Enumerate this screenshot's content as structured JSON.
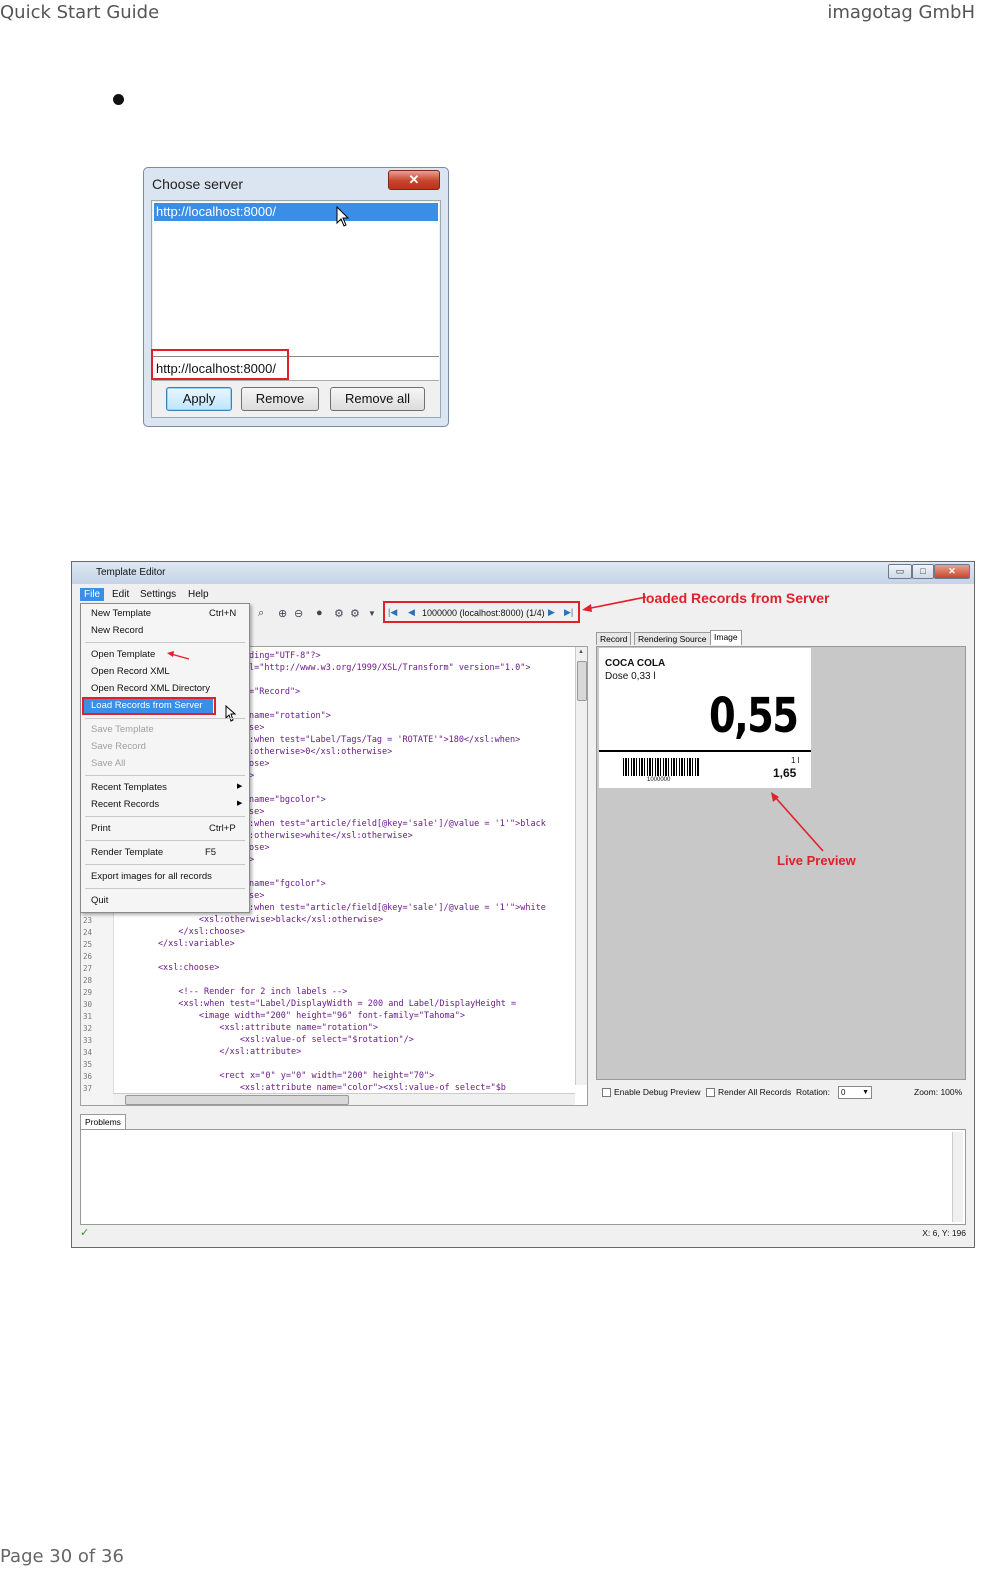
{
  "header": {
    "left": "Quick Start Guide",
    "right": "imagotag GmbH"
  },
  "footer": {
    "page": "Page 30 of 36"
  },
  "dialog": {
    "title": "Choose server",
    "close_icon": "close-icon",
    "list_item": "http://localhost:8000/",
    "input_value": "http://localhost:8000/",
    "buttons": {
      "apply": "Apply",
      "remove": "Remove",
      "remove_all": "Remove all"
    }
  },
  "editor": {
    "title": "Template Editor",
    "window_buttons": {
      "minimize": "▭",
      "maximize": "□",
      "close": "✕"
    },
    "menu": {
      "file": "File",
      "edit": "Edit",
      "settings": "Settings",
      "help": "Help"
    },
    "file_menu": {
      "new_template": "New Template",
      "new_template_sc": "Ctrl+N",
      "new_record": "New Record",
      "open_template": "Open Template",
      "open_record_xml": "Open Record XML",
      "open_record_xml_dir": "Open Record XML Directory",
      "load_records": "Load Records from Server",
      "save_template": "Save Template",
      "save_record": "Save Record",
      "save_all": "Save All",
      "recent_templates": "Recent Templates",
      "recent_records": "Recent Records",
      "print": "Print",
      "print_sc": "Ctrl+P",
      "render_template": "Render Template",
      "render_sc": "F5",
      "export_images": "Export images for all records",
      "quit": "Quit"
    },
    "nav_record": "1000000 (localhost:8000) (1/4)",
    "code_lines": [
      {
        "n": "",
        "t": "ding=\"UTF-8\"?>"
      },
      {
        "n": "",
        "t": "l=\"http://www.w3.org/1999/XSL/Transform\" version=\"1.0\">"
      },
      {
        "n": "",
        "t": ""
      },
      {
        "n": "",
        "t": "=\"Record\">"
      },
      {
        "n": "",
        "t": ""
      },
      {
        "n": "",
        "t": "name=\"rotation\">"
      },
      {
        "n": "",
        "t": "se>"
      },
      {
        "n": "",
        "t": ":when test=\"Label/Tags/Tag = 'ROTATE'\">180</xsl:when>"
      },
      {
        "n": "",
        "t": ":otherwise>0</xsl:otherwise>"
      },
      {
        "n": "",
        "t": "ose>"
      },
      {
        "n": "",
        "t": ">"
      },
      {
        "n": "",
        "t": ""
      },
      {
        "n": "",
        "t": "name=\"bgcolor\">"
      },
      {
        "n": "",
        "t": "se>"
      },
      {
        "n": "",
        "t": ":when test=\"article/field[@key='sale']/@value = '1'\">black"
      },
      {
        "n": "",
        "t": ":otherwise>white</xsl:otherwise>"
      },
      {
        "n": "",
        "t": "ose>"
      },
      {
        "n": "",
        "t": ">"
      },
      {
        "n": "",
        "t": ""
      },
      {
        "n": "",
        "t": "name=\"fgcolor\">"
      },
      {
        "n": "",
        "t": "se>"
      },
      {
        "n": "",
        "t": ":when test=\"article/field[@key='sale']/@value = '1'\">white"
      },
      {
        "n": "23",
        "t": "                <xsl:otherwise>black</xsl:otherwise>"
      },
      {
        "n": "24",
        "t": "            </xsl:choose>"
      },
      {
        "n": "25",
        "t": "        </xsl:variable>"
      },
      {
        "n": "26",
        "t": ""
      },
      {
        "n": "27",
        "t": "        <xsl:choose>"
      },
      {
        "n": "28",
        "t": ""
      },
      {
        "n": "29",
        "t": "            <!-- Render for 2 inch labels -->"
      },
      {
        "n": "30",
        "t": "            <xsl:when test=\"Label/DisplayWidth = 200 and Label/DisplayHeight ="
      },
      {
        "n": "31",
        "t": "                <image width=\"200\" height=\"96\" font-family=\"Tahoma\">"
      },
      {
        "n": "32",
        "t": "                    <xsl:attribute name=\"rotation\">"
      },
      {
        "n": "33",
        "t": "                        <xsl:value-of select=\"$rotation\"/>"
      },
      {
        "n": "34",
        "t": "                    </xsl:attribute>"
      },
      {
        "n": "35",
        "t": ""
      },
      {
        "n": "36",
        "t": "                    <rect x=\"0\" y=\"0\" width=\"200\" height=\"70\">"
      },
      {
        "n": "37",
        "t": "                        <xsl:attribute name=\"color\"><xsl:value-of select=\"$b"
      }
    ],
    "tabs": {
      "record": "Record",
      "rendering_source": "Rendering Source",
      "image": "Image"
    },
    "label": {
      "name": "COCA COLA",
      "sub": "Dose 0,33 l",
      "price": "0,55",
      "ean": "1000000",
      "unit": "1 l",
      "unit_price": "1,65"
    },
    "preview_bottom": {
      "debug": "Enable Debug Preview",
      "render_all": "Render All Records",
      "rotation_label": "Rotation:",
      "rotation_value": "0",
      "zoom": "Zoom: 100%"
    },
    "problems_tab": "Problems",
    "status_coords": "X: 6, Y: 196"
  },
  "annotations": {
    "loaded_records": "loaded Records from Server",
    "live_preview": "Live Preview"
  },
  "colors": {
    "annotation": "#e0202a",
    "selection": "#3a8ee6"
  }
}
